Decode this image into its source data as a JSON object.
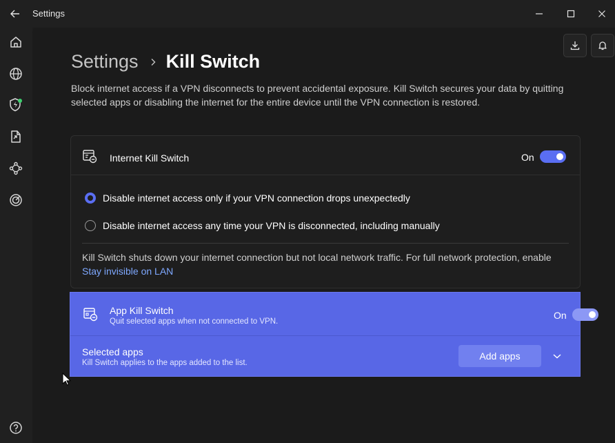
{
  "window": {
    "title": "Settings"
  },
  "sidebar": {
    "items": [
      {
        "icon": "home-icon"
      },
      {
        "icon": "globe-icon"
      },
      {
        "icon": "shield-icon"
      },
      {
        "icon": "split-tunnel-icon"
      },
      {
        "icon": "meshnet-icon"
      },
      {
        "icon": "target-icon"
      }
    ],
    "help_icon": "help-icon"
  },
  "header": {
    "breadcrumb_parent": "Settings",
    "breadcrumb_current": "Kill Switch",
    "description": "Block internet access if a VPN disconnects to prevent accidental exposure. Kill Switch secures your data by quitting selected apps or disabling the internet for the entire device until the VPN connection is restored."
  },
  "internet_kill_switch": {
    "title": "Internet Kill Switch",
    "toggle_label": "On",
    "options": [
      {
        "label": "Disable internet access only if your VPN connection drops unexpectedly",
        "selected": true
      },
      {
        "label": "Disable internet access any time your VPN is disconnected, including manually",
        "selected": false
      }
    ],
    "note": "Kill Switch shuts down your internet connection but not local network traffic. For full network protection, enable",
    "note_link": "Stay invisible on LAN"
  },
  "app_kill_switch": {
    "title": "App Kill Switch",
    "subtitle": "Quit selected apps when not connected to VPN.",
    "toggle_label": "On",
    "selected_apps_title": "Selected apps",
    "selected_apps_subtitle": "Kill Switch applies to the apps added to the list.",
    "add_apps_label": "Add apps"
  },
  "colors": {
    "accent": "#5a6ef2",
    "card_highlight": "#5867e6",
    "link": "#7ea8ff"
  }
}
